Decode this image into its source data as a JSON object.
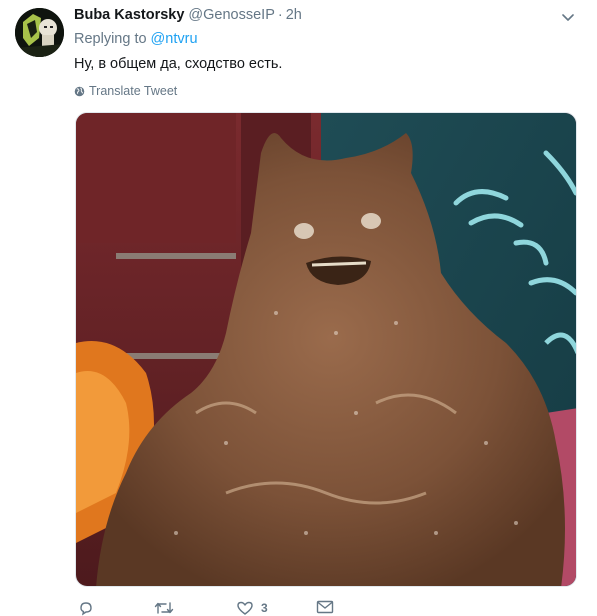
{
  "tweet": {
    "display_name": "Buba Kastorsky",
    "handle": "@GenosseIP",
    "separator": "·",
    "time": "2h",
    "replying_prefix": "Replying to",
    "replying_to": "@ntvru",
    "text": "Ну, в общем да, сходство есть.",
    "translate_label": "Translate Tweet",
    "like_count": "3"
  },
  "colors": {
    "link": "#1da1f2",
    "secondary": "#657786",
    "primary_text": "#14171a"
  },
  "icons": {
    "more": "chevron-down-icon",
    "translate": "globe-icon",
    "reply": "reply-icon",
    "retweet": "retweet-icon",
    "like": "heart-icon",
    "dm": "envelope-icon"
  }
}
